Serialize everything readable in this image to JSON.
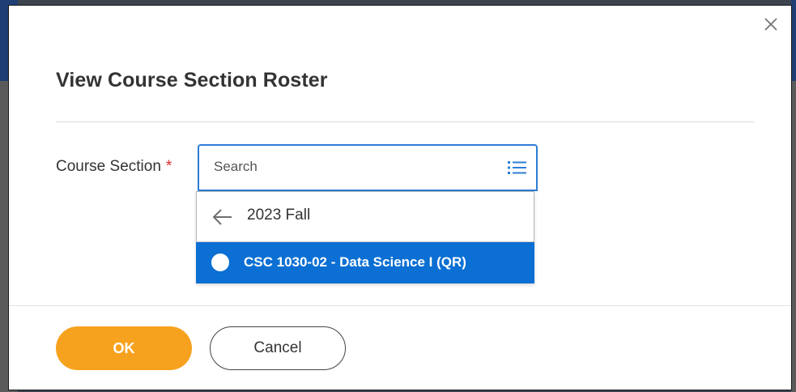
{
  "dialog": {
    "title": "View Course Section Roster",
    "close_icon": "close-icon"
  },
  "form": {
    "field_label": "Course Section",
    "required_marker": "*",
    "search": {
      "placeholder": "Search",
      "value": "",
      "icon": "list-icon"
    }
  },
  "dropdown": {
    "back_icon": "arrow-left-icon",
    "back_label": "2023 Fall",
    "options": [
      {
        "label": "CSC 1030-02 - Data Science I (QR)",
        "selected": false,
        "highlighted": true
      }
    ]
  },
  "footer": {
    "ok_label": "OK",
    "cancel_label": "Cancel"
  },
  "colors": {
    "primary_button": "#f7a21f",
    "highlight": "#0b6fd3",
    "focus_border": "#2d7dd6",
    "required": "#de2c2c"
  }
}
